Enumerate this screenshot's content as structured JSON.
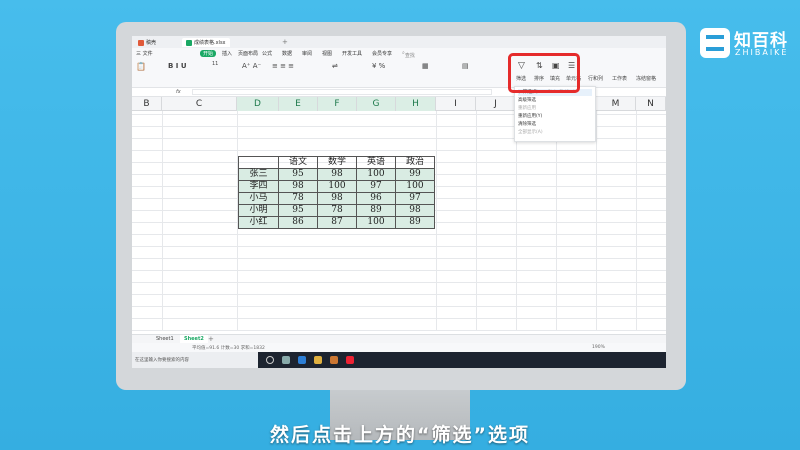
{
  "brand": {
    "name_cn": "知百科",
    "name_en": "ZHIBAIKE"
  },
  "caption": "然后点击上方的“筛选”选项",
  "window": {
    "tabs": [
      {
        "label": "稿壳"
      },
      {
        "label": "成绩表格.xlsx"
      }
    ],
    "menu": [
      "三 文件",
      "开始",
      "插入",
      "页面布局",
      "公式",
      "数据",
      "审阅",
      "视图",
      "开发工具",
      "会员专享"
    ],
    "search": "查找命令、搜索模板"
  },
  "ribbon": {
    "font_size": "11",
    "filter_label": "筛选",
    "sort_label": "排序",
    "fill_label": "填充",
    "cell_label": "单元格",
    "rowcol_label": "行和列",
    "sheet_label": "工作表",
    "freeze_label": "冻结窗格"
  },
  "formula_bar": {
    "fx": "fx"
  },
  "columns": [
    "B",
    "C",
    "D",
    "E",
    "F",
    "G",
    "H",
    "I",
    "J",
    "K",
    "L",
    "M",
    "N"
  ],
  "table": {
    "headers": [
      "",
      "语文",
      "数学",
      "英语",
      "政治"
    ],
    "rows": [
      [
        "张三",
        "95",
        "98",
        "100",
        "99"
      ],
      [
        "李四",
        "98",
        "100",
        "97",
        "100"
      ],
      [
        "小马",
        "78",
        "98",
        "96",
        "97"
      ],
      [
        "小明",
        "95",
        "78",
        "89",
        "98"
      ],
      [
        "小红",
        "86",
        "87",
        "100",
        "89"
      ]
    ]
  },
  "dropdown": {
    "items": [
      "筛选(F)",
      "高级筛选",
      "重新应用",
      "重新应用(Y)",
      "清除筛选",
      "全部显示(A)"
    ],
    "shortcut": "Ctrl+Shift+L"
  },
  "sheets": [
    "Sheet1",
    "Sheet2"
  ],
  "status": {
    "left": "平均值=91.6  计数=30  求和=1832",
    "zoom": "190%"
  },
  "input_hint": "在这里输入你要搜索的内容"
}
